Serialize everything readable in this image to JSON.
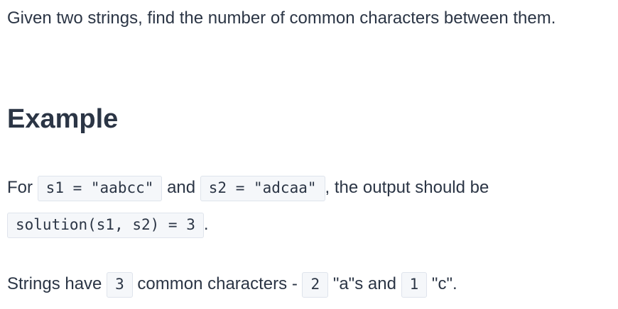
{
  "description": {
    "line": "Given two strings, find the number of common characters between them."
  },
  "example": {
    "heading": "Example",
    "prefix": "For",
    "s1_code": "s1 = \"aabcc\"",
    "and_text": "and",
    "s2_code": "s2 = \"adcaa\"",
    "output_text": ", the output should be",
    "solution_code": "solution(s1, s2) = 3",
    "period": "."
  },
  "summary": {
    "prefix": "Strings have",
    "count_code": "3",
    "middle": "common characters -",
    "a_count_code": "2",
    "a_text": "\"a\"s and",
    "c_count_code": "1",
    "c_text": "\"c\"."
  }
}
